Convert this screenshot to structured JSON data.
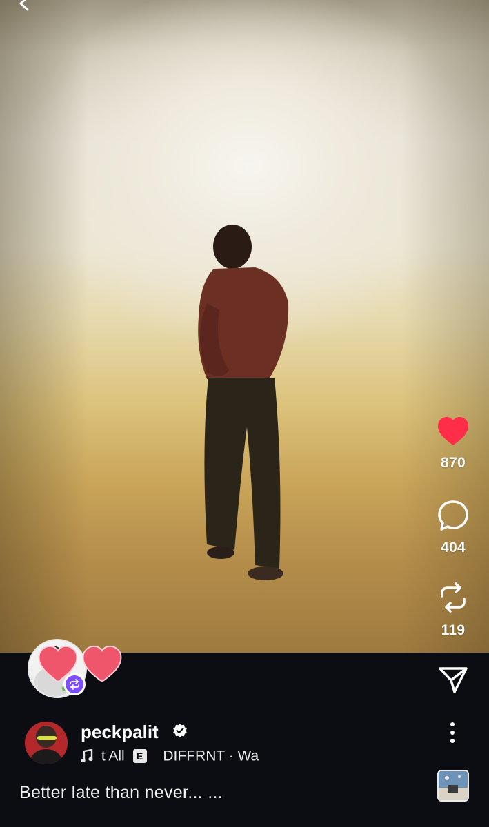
{
  "post": {
    "username": "peckpalit",
    "music_text": "t All",
    "explicit_label": "E",
    "artist_text": "DIFFRNT · Wa",
    "caption": "Better late than never... ..."
  },
  "actions": {
    "like_count": "870",
    "comment_count": "404",
    "repost_count": "119"
  },
  "icons": {
    "back": "chevron-left-icon",
    "like": "heart-icon",
    "comment": "comment-bubble-icon",
    "repost": "repost-icon",
    "share": "send-icon",
    "more": "more-vertical-icon",
    "music": "music-note-icon",
    "verified": "verified-badge-icon"
  },
  "colors": {
    "like_red": "#ff2d47",
    "repost_badge": "#7b4dff",
    "background": "#0b0d12"
  }
}
